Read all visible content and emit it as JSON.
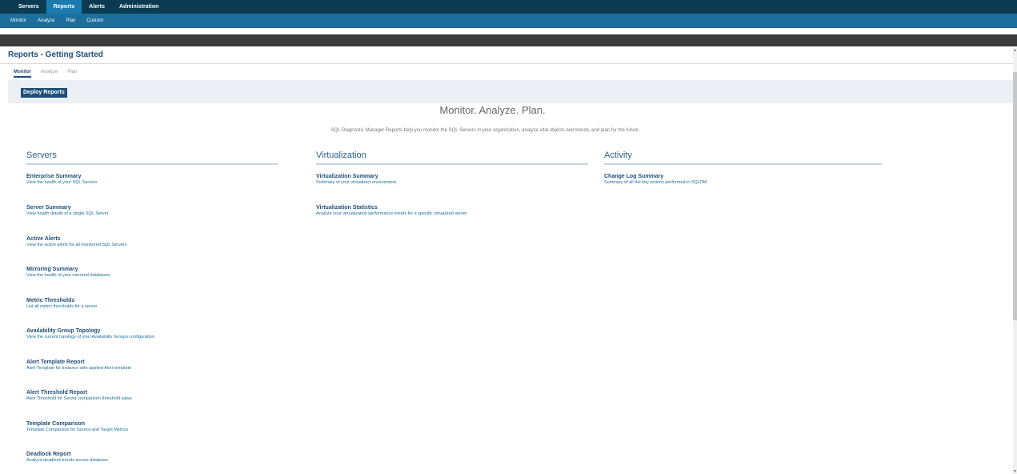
{
  "top_nav": [
    "Servers",
    "Reports",
    "Alerts",
    "Administration"
  ],
  "sub_nav": [
    "Monitor",
    "Analyze",
    "Plan",
    "Custom"
  ],
  "page_title": "Reports - Getting Started",
  "tabs": [
    "Monitor",
    "Analyze",
    "Plan"
  ],
  "deploy_button": "Deploy Reports",
  "headline": "Monitor. Analyze. Plan.",
  "intro": "SQL Diagnostic Manager Reports help you monitor the SQL Servers in your organization, analyze vital objects and trends, and plan for the future.",
  "columns": [
    {
      "heading": "Servers",
      "reports": [
        {
          "name": "Enterprise Summary",
          "desc": "View the health of your SQL Servers"
        },
        {
          "name": "Server Summary",
          "desc": "View health details of a single SQL Server"
        },
        {
          "name": "Active Alerts",
          "desc": "View the active alerts for all monitored SQL Servers"
        },
        {
          "name": "Mirroring Summary",
          "desc": "View the health of your mirrored databases"
        },
        {
          "name": "Metric Thresholds",
          "desc": "List all metric thresholds for a server"
        },
        {
          "name": "Availability Group Topology",
          "desc": "View the current topology of your Availability Groups configuration"
        },
        {
          "name": "Alert Template Report",
          "desc": "Alert Template for Instance with applied Alert template"
        },
        {
          "name": "Alert Threshold Report",
          "desc": "Alert Threshold for Server comparison threshold value"
        },
        {
          "name": "Template Comparison",
          "desc": "Template Comparison for Source and Target Metrics"
        },
        {
          "name": "Deadlock Report",
          "desc": "Analyze deadlock trends across database"
        }
      ]
    },
    {
      "heading": "Virtualization",
      "reports": [
        {
          "name": "Virtualization Summary",
          "desc": "Summary of your virtualized environment"
        },
        {
          "name": "Virtualization Statistics",
          "desc": "Analyze your virtualization performance trends for a specific virtualized server"
        }
      ]
    },
    {
      "heading": "Activity",
      "reports": [
        {
          "name": "Change Log Summary",
          "desc": "Summary of all the key actions performed in SQLDM"
        }
      ]
    }
  ],
  "icons": {
    "scroll_up": "scroll-up-arrow-icon",
    "scroll_down": "scroll-down-arrow-icon"
  },
  "colors": {
    "nav_dark": "#0b3a52",
    "nav_active": "#1a7bb0",
    "subnav": "#1c6f9c",
    "link": "#1d4f78"
  }
}
